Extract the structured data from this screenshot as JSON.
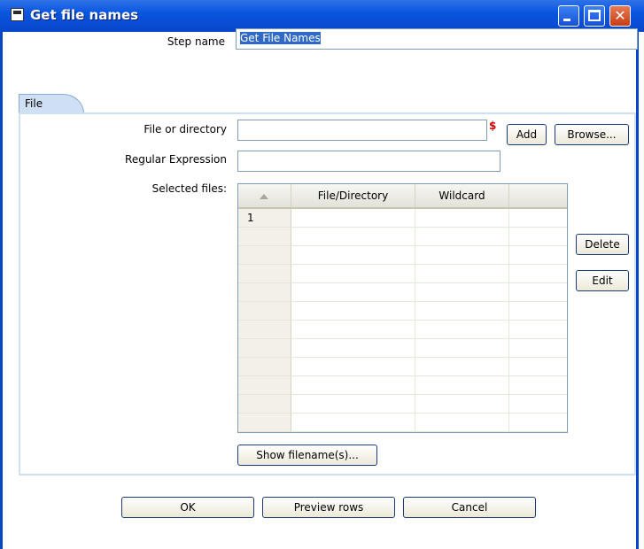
{
  "window": {
    "title": "Get file names",
    "icon": "dialog-icon",
    "controls": {
      "minimize": "minimize-icon",
      "maximize": "maximize-icon",
      "close_symbol": "✕"
    }
  },
  "form": {
    "step_name_label": "Step name",
    "step_name_value": "Get File Names"
  },
  "tabs": [
    {
      "label": "File",
      "active": true
    }
  ],
  "file_tab": {
    "file_or_directory_label": "File or directory",
    "file_or_directory_value": "",
    "variable_marker": "$",
    "add_button": "Add",
    "browse_button": "Browse...",
    "regex_label": "Regular Expression",
    "regex_value": "",
    "selected_files_label": "Selected files:",
    "table": {
      "columns": [
        "",
        "File/Directory",
        "Wildcard",
        ""
      ],
      "rows": [
        {
          "num": "1",
          "file": "",
          "wildcard": ""
        },
        {
          "num": "",
          "file": "",
          "wildcard": ""
        },
        {
          "num": "",
          "file": "",
          "wildcard": ""
        },
        {
          "num": "",
          "file": "",
          "wildcard": ""
        },
        {
          "num": "",
          "file": "",
          "wildcard": ""
        },
        {
          "num": "",
          "file": "",
          "wildcard": ""
        },
        {
          "num": "",
          "file": "",
          "wildcard": ""
        },
        {
          "num": "",
          "file": "",
          "wildcard": ""
        },
        {
          "num": "",
          "file": "",
          "wildcard": ""
        },
        {
          "num": "",
          "file": "",
          "wildcard": ""
        },
        {
          "num": "",
          "file": "",
          "wildcard": ""
        },
        {
          "num": "",
          "file": "",
          "wildcard": ""
        }
      ]
    },
    "delete_button": "Delete",
    "edit_button": "Edit",
    "show_filenames_button": "Show filename(s)..."
  },
  "footer": {
    "ok_button": "OK",
    "preview_button": "Preview rows",
    "cancel_button": "Cancel"
  },
  "colors": {
    "title_bar": "#0a55e0",
    "tab_background": "#cfe0f5",
    "selection": "#316ac5",
    "variable_marker": "#d00000"
  }
}
